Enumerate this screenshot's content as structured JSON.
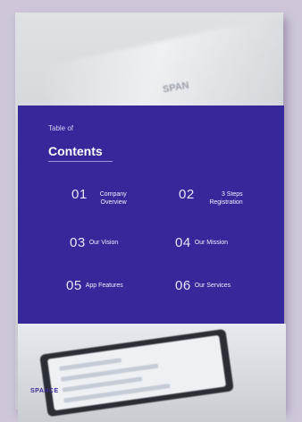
{
  "background_brand": "SPAN",
  "toc": {
    "subtitle": "Table of",
    "title": "Contents",
    "items": [
      {
        "num": "01",
        "label": "Company Overview"
      },
      {
        "num": "02",
        "label": "3 Steps Registration"
      },
      {
        "num": "03",
        "label": "Our Vision"
      },
      {
        "num": "04",
        "label": "Our Mission"
      },
      {
        "num": "05",
        "label": "App Features"
      },
      {
        "num": "06",
        "label": "Our Services"
      }
    ]
  },
  "footer_brand": "SPANCE",
  "colors": {
    "panel": "#36279a",
    "brand": "#3a2d9a"
  }
}
